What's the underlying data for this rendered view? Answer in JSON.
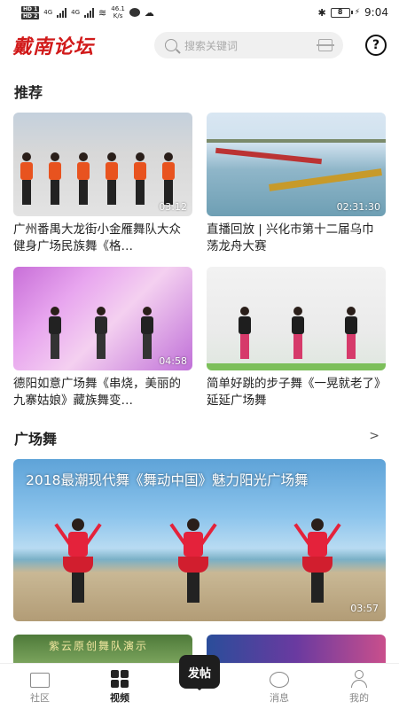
{
  "status_bar": {
    "hd1": "HD 1",
    "hd2": "HD 2",
    "net1": "4G",
    "net2": "4G",
    "speed": "46.1",
    "speed_unit": "K/s",
    "battery": "8",
    "time": "9:04"
  },
  "header": {
    "logo": "戴南论坛",
    "search_placeholder": "搜索关键词"
  },
  "sections": {
    "recommend_title": "推荐",
    "square_dance_title": "广场舞",
    "more_glyph": ">"
  },
  "recommend": [
    {
      "title": "广州番禺大龙街小金雁舞队大众健身广场民族舞《格…",
      "duration": "03:12"
    },
    {
      "title": "直播回放 | 兴化市第十二届乌巾荡龙舟大赛",
      "duration": "02:31:30"
    },
    {
      "title": "德阳如意广场舞《串烧，美丽的九寨姑娘》藏族舞变…",
      "duration": "04:58"
    },
    {
      "title": "简单好跳的步子舞《一晃就老了》延延广场舞",
      "duration": ""
    }
  ],
  "square_dance": {
    "banner_title": "2018最潮现代舞《舞动中国》魅力阳光广场舞",
    "banner_duration": "03:57",
    "peek_text": "紫云原创舞队演示"
  },
  "bottom_nav": [
    {
      "label": "社区",
      "icon": "chat-square-icon",
      "active": false
    },
    {
      "label": "视频",
      "icon": "grid-icon",
      "active": true
    },
    {
      "label": "发帖",
      "icon": "post-button",
      "active": false
    },
    {
      "label": "消息",
      "icon": "message-bubble-icon",
      "active": false
    },
    {
      "label": "我的",
      "icon": "user-icon",
      "active": false
    }
  ],
  "colors": {
    "brand_red": "#d11a1a",
    "post_button_bg": "#1e1e1e"
  }
}
